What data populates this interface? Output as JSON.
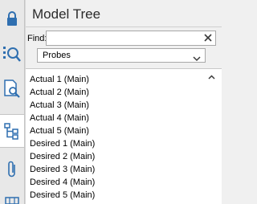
{
  "toolbar": {
    "buttons": [
      {
        "icon": "lock-icon"
      },
      {
        "icon": "search-list-icon"
      },
      {
        "icon": "document-search-icon"
      },
      {
        "icon": "tree-icon",
        "active": true
      },
      {
        "icon": "paperclip-icon"
      },
      {
        "icon": "grid-icon"
      }
    ]
  },
  "panel": {
    "title": "Model Tree"
  },
  "find": {
    "label": "Find:",
    "value": "",
    "placeholder": "",
    "clear_icon": "close-icon"
  },
  "filter": {
    "selected": "Probes",
    "arrow_icon": "chevron-down-icon"
  },
  "tree": {
    "items": [
      "Actual 1 (Main)",
      "Actual 2 (Main)",
      "Actual 3 (Main)",
      "Actual 4 (Main)",
      "Actual 5 (Main)",
      "Desired 1 (Main)",
      "Desired 2 (Main)",
      "Desired 3 (Main)",
      "Desired 4 (Main)",
      "Desired 5 (Main)"
    ],
    "scroll_icon": "chevron-up-icon"
  },
  "colors": {
    "icon_blue": "#2f6fb0",
    "icon_dark": "#3a3a3a",
    "panel_bg": "#f0f0f0"
  }
}
